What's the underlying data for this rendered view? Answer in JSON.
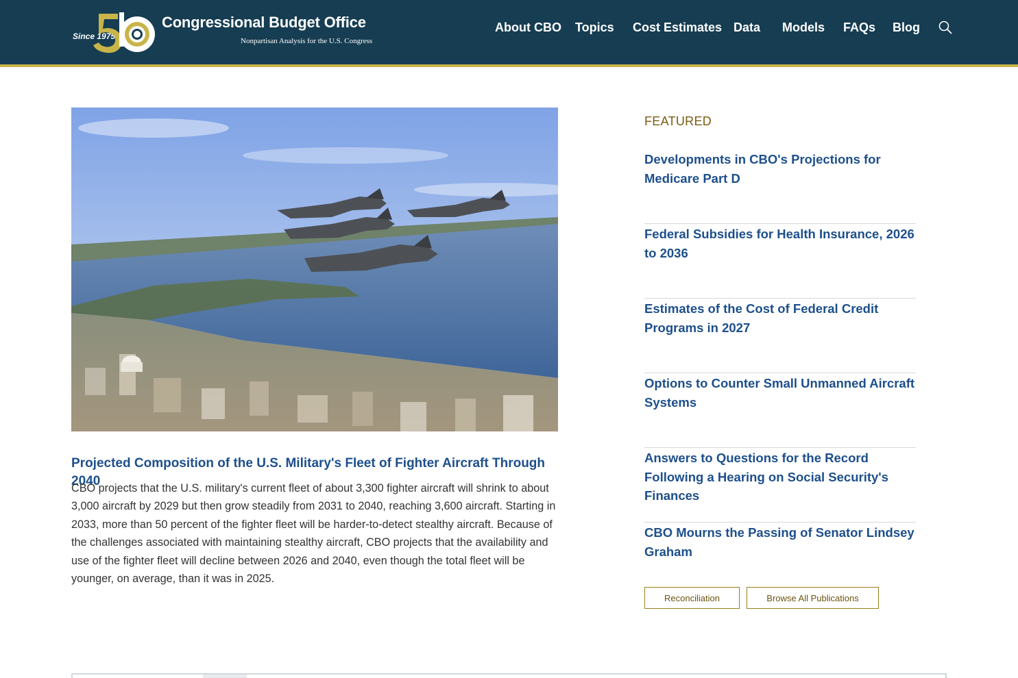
{
  "header": {
    "logo": {
      "since": "Since 1975",
      "anniversary": "50",
      "title": "Congressional Budget Office",
      "subtitle": "Nonpartisan Analysis for the U.S. Congress"
    },
    "nav": [
      {
        "label": "About CBO"
      },
      {
        "label": "Topics"
      },
      {
        "label": "Cost Estimates"
      },
      {
        "label": "Data"
      },
      {
        "label": "Models"
      },
      {
        "label": "FAQs"
      },
      {
        "label": "Blog"
      }
    ],
    "search_icon": "search-icon"
  },
  "main_story": {
    "image_desc": "fighter-jets-over-city",
    "title": "Projected Composition of the U.S. Military's Fleet of Fighter Aircraft Through 2040",
    "summary": "CBO projects that the U.S. military's current fleet of about 3,300 fighter aircraft will shrink to about 3,000 aircraft by 2029 but then grow steadily from 2031 to 2040, reaching 3,600 aircraft. Starting in 2033, more than 50 percent of the fighter fleet will be harder-to-detect stealthy aircraft. Because of the challenges associated with maintaining stealthy aircraft, CBO projects that the availability and use of the fighter fleet will decline between 2026 and 2040, even though the total fleet will be younger, on average, than it was in 2025."
  },
  "featured": {
    "label": "FEATURED",
    "items": [
      {
        "title": "Developments in CBO's Projections for Medicare Part D"
      },
      {
        "title": "Federal Subsidies for Health Insurance, 2026 to 2036"
      },
      {
        "title": "Estimates of the Cost of Federal Credit Programs in 2027"
      },
      {
        "title": "Options to Counter Small Unmanned Aircraft Systems"
      },
      {
        "title": "Answers to Questions for the Record Following a Hearing on Social Security's Finances"
      },
      {
        "title": "CBO Mourns the Passing of Senator Lindsey Graham"
      }
    ],
    "buttons": {
      "reconciliation": "Reconciliation",
      "browse_all": "Browse All Publications"
    }
  },
  "colors": {
    "header_bg": "#163d52",
    "header_accent": "#c8b449",
    "link": "#1d4f8c",
    "featured_label": "#7a5c12"
  }
}
